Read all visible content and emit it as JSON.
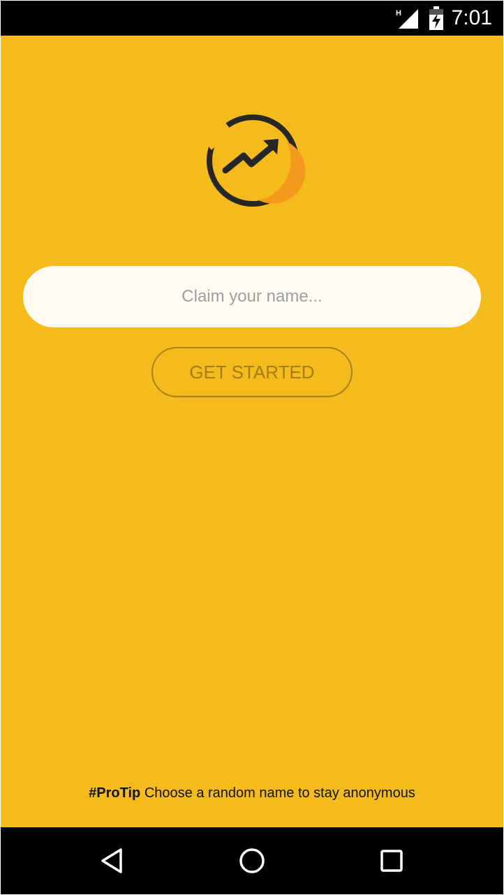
{
  "status_bar": {
    "time": "7:01",
    "network_type": "H",
    "icons": [
      "signal-icon",
      "battery-charging-icon"
    ]
  },
  "logo": {
    "icon": "trending-up-circle-icon"
  },
  "name_input": {
    "placeholder": "Claim your name...",
    "value": ""
  },
  "get_started": {
    "label": "GET STARTED"
  },
  "protip": {
    "tag": "#ProTip",
    "text": " Choose a random name to stay anonymous"
  },
  "nav_bar": {
    "icons": [
      "back-icon",
      "home-icon",
      "recents-icon"
    ]
  },
  "colors": {
    "background": "#F5BA1B",
    "input_background": "#FEFBF2",
    "button_border": "#A9821A",
    "button_text": "#A47E15",
    "logo_accent": "#F39A1E",
    "logo_stroke": "#262626"
  }
}
